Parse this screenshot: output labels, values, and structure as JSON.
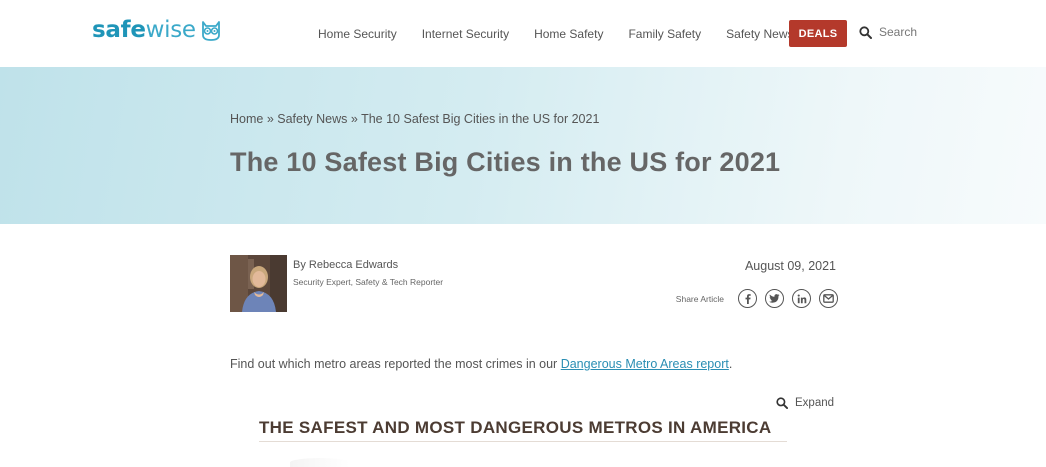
{
  "header": {
    "logo": {
      "strong": "safe",
      "light": "wise"
    },
    "nav": [
      {
        "label": "Home Security"
      },
      {
        "label": "Internet Security"
      },
      {
        "label": "Home Safety"
      },
      {
        "label": "Family Safety"
      },
      {
        "label": "Safety News"
      }
    ],
    "deals_label": "DEALS",
    "search_label": "Search"
  },
  "hero": {
    "breadcrumb": {
      "home": "Home",
      "sep": " » ",
      "section": "Safety News",
      "current": "The 10 Safest Big Cities in the US for 2021"
    },
    "title": "The 10 Safest Big Cities in the US for 2021"
  },
  "author": {
    "name": "By Rebecca Edwards",
    "role": "Security Expert, Safety & Tech Reporter",
    "date": "August 09, 2021"
  },
  "share": {
    "label": "Share Article",
    "icons": [
      "facebook-icon",
      "twitter-icon",
      "linkedin-icon",
      "email-icon"
    ]
  },
  "intro": {
    "before": "Find out which metro areas reported the most crimes in our ",
    "link": "Dangerous Metro Areas report",
    "after": "."
  },
  "expand_label": "Expand",
  "infographic": {
    "title": "THE SAFEST AND MOST DANGEROUS METROS IN AMERICA"
  },
  "colors": {
    "brand": "#1f95b8",
    "deals": "#b4392b",
    "link": "#2a8eb3",
    "infographic_title": "#4c3c33"
  }
}
